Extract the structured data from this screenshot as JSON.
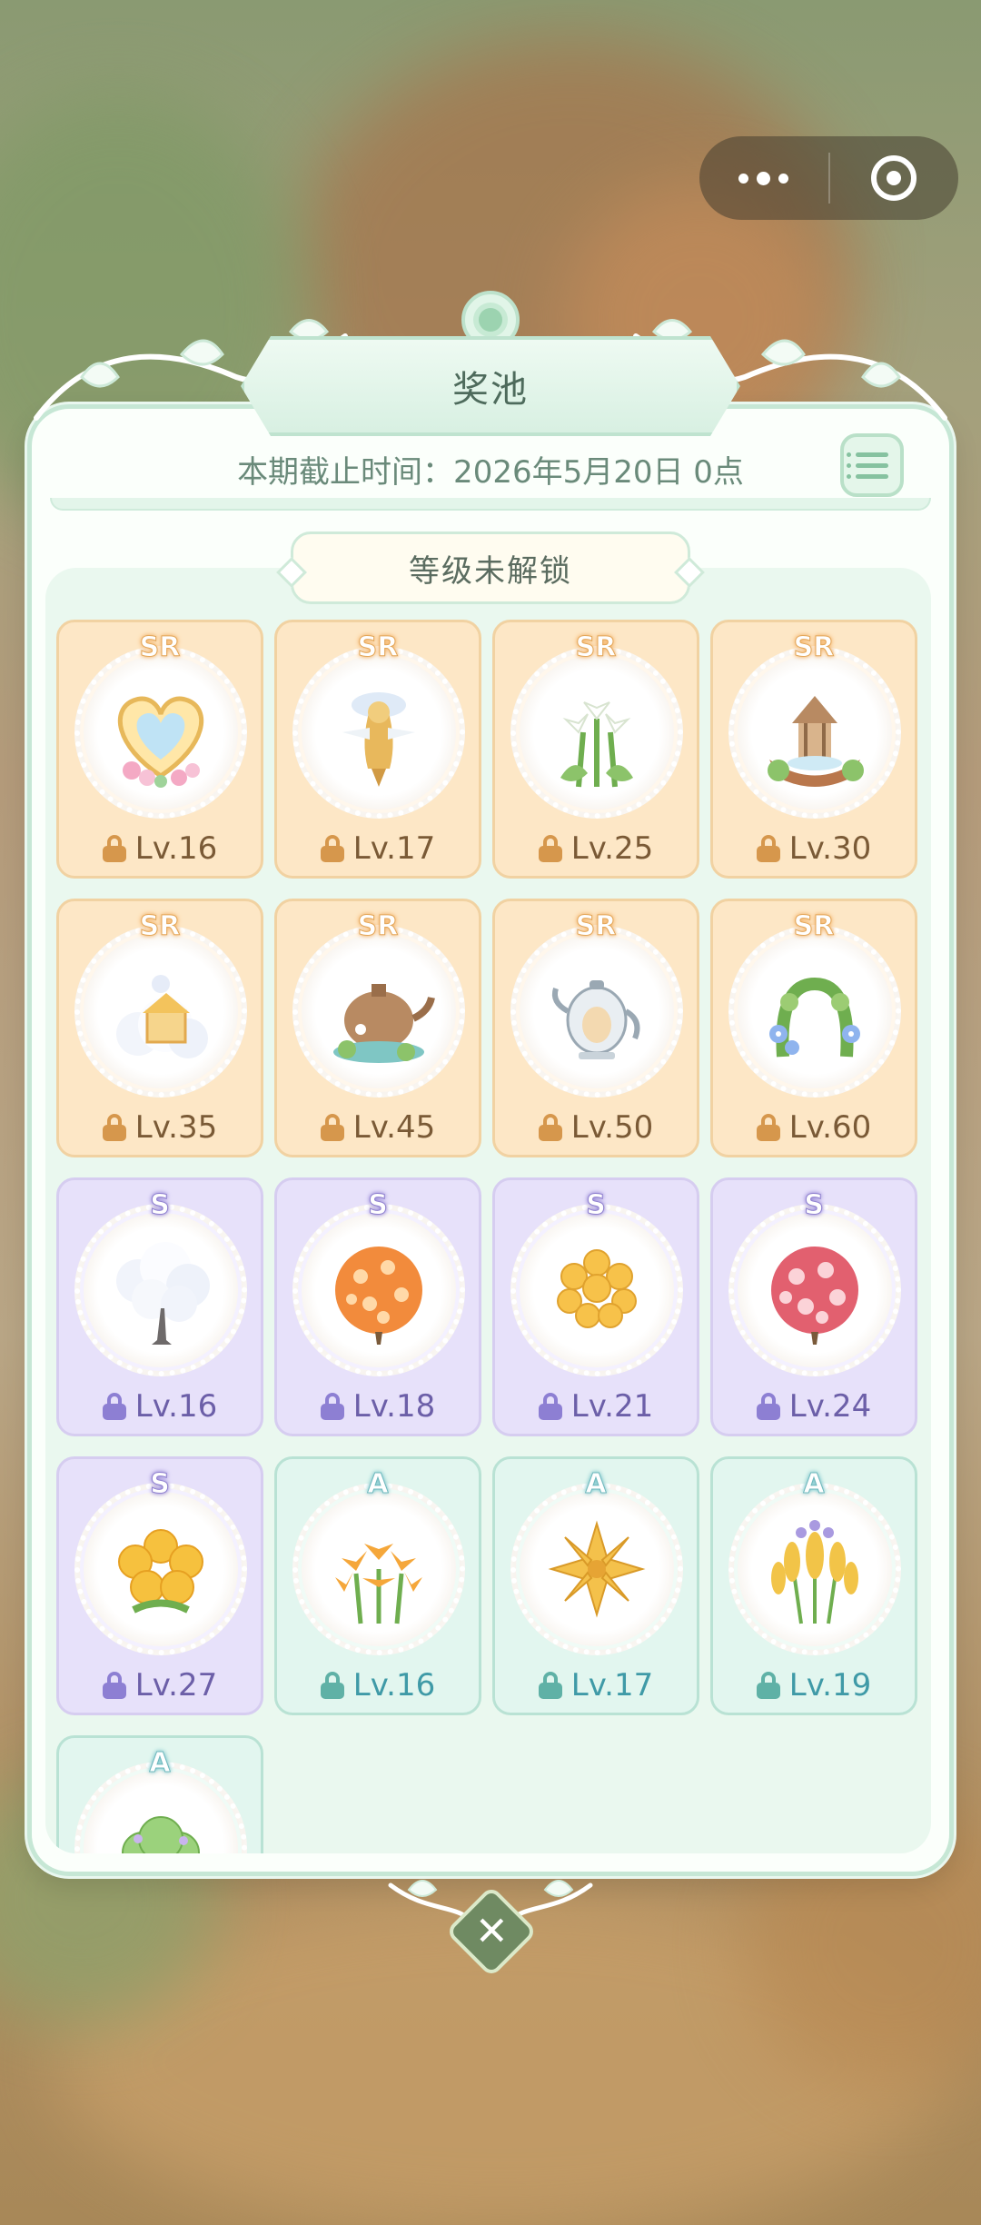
{
  "popup": {
    "title": "奖池",
    "deadline": "本期截止时间：2026年5月20日 0点",
    "section_label": "等级未解锁"
  },
  "items": [
    {
      "rank": "SR",
      "level": "Lv.16",
      "art": "heart-frame"
    },
    {
      "rank": "SR",
      "level": "Lv.17",
      "art": "golden-statue"
    },
    {
      "rank": "SR",
      "level": "Lv.25",
      "art": "white-lilies"
    },
    {
      "rank": "SR",
      "level": "Lv.30",
      "art": "gazebo-fountain"
    },
    {
      "rank": "SR",
      "level": "Lv.35",
      "art": "cloud-house"
    },
    {
      "rank": "SR",
      "level": "Lv.45",
      "art": "teapot-house"
    },
    {
      "rank": "SR",
      "level": "Lv.50",
      "art": "porcelain-teapot"
    },
    {
      "rank": "SR",
      "level": "Lv.60",
      "art": "flower-arch"
    },
    {
      "rank": "S",
      "level": "Lv.16",
      "art": "cloud-tree"
    },
    {
      "rank": "S",
      "level": "Lv.18",
      "art": "orange-flower-ball"
    },
    {
      "rank": "S",
      "level": "Lv.21",
      "art": "golden-berry-ball"
    },
    {
      "rank": "S",
      "level": "Lv.24",
      "art": "pink-flower-ball"
    },
    {
      "rank": "S",
      "level": "Lv.27",
      "art": "yellow-bloom-bush"
    },
    {
      "rank": "A",
      "level": "Lv.16",
      "art": "orange-lilies"
    },
    {
      "rank": "A",
      "level": "Lv.17",
      "art": "golden-star-flower"
    },
    {
      "rank": "A",
      "level": "Lv.19",
      "art": "wheat-lavender"
    },
    {
      "rank": "A",
      "level": "",
      "art": "green-bush"
    }
  ],
  "colors": {
    "sr_card": "#fde7c6",
    "s_card": "#e7e1fa",
    "a_card": "#e2f6ef",
    "panel_border": "#c6e7d5"
  }
}
